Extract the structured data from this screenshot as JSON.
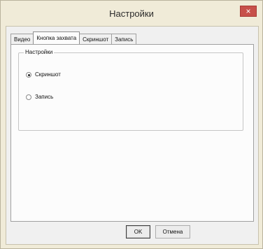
{
  "window": {
    "title": "Настройки",
    "close_glyph": "×"
  },
  "tabs": [
    {
      "label": "Видео",
      "active": false
    },
    {
      "label": "Кнопка захвата",
      "active": true
    },
    {
      "label": "Скриншот",
      "active": false
    },
    {
      "label": "Запись",
      "active": false
    }
  ],
  "group": {
    "title": "Настройки",
    "options": [
      {
        "label": "Скриншот",
        "checked": true
      },
      {
        "label": "Запись",
        "checked": false
      }
    ]
  },
  "buttons": {
    "ok": "OK",
    "cancel": "Отмена"
  }
}
